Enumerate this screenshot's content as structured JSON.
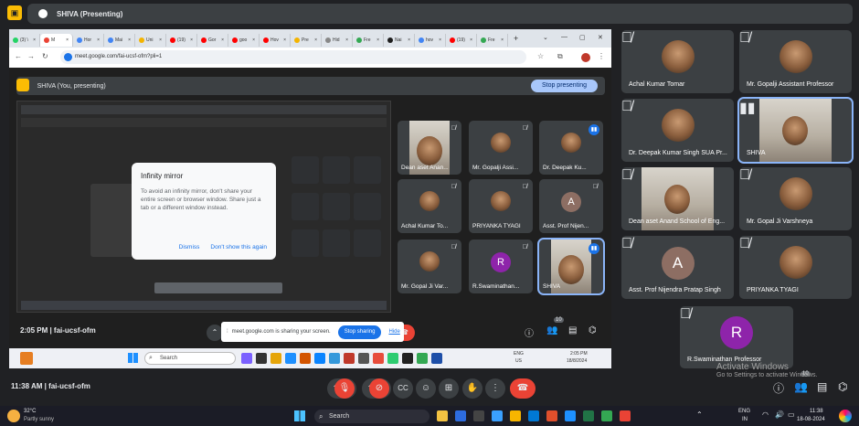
{
  "top_bar": {
    "title": "SHIVA (Presenting)"
  },
  "browser": {
    "tabs": [
      {
        "label": "(3) \\",
        "color": "#25d366",
        "active": false
      },
      {
        "label": "M",
        "color": "#ea4335",
        "active": true
      },
      {
        "label": "Hor",
        "color": "#4285f4",
        "active": false
      },
      {
        "label": "Mai",
        "color": "#4285f4",
        "active": false
      },
      {
        "label": "Uni",
        "color": "#f4b400",
        "active": false
      },
      {
        "label": "(19)",
        "color": "#ff0000",
        "active": false
      },
      {
        "label": "Gor",
        "color": "#ff0000",
        "active": false
      },
      {
        "label": "goo",
        "color": "#ff0000",
        "active": false
      },
      {
        "label": "Hov",
        "color": "#ff0000",
        "active": false
      },
      {
        "label": "Pre",
        "color": "#f4b400",
        "active": false
      },
      {
        "label": "Hid",
        "color": "#888888",
        "active": false
      },
      {
        "label": "Fre",
        "color": "#34a853",
        "active": false
      },
      {
        "label": "Nai",
        "color": "#1e1e1e",
        "active": false
      },
      {
        "label": "hov",
        "color": "#4285f4",
        "active": false
      },
      {
        "label": "(19)",
        "color": "#ff0000",
        "active": false
      },
      {
        "label": "Fre",
        "color": "#34a853",
        "active": false
      }
    ],
    "new_tab": "+",
    "window_controls": [
      "⌄",
      "—",
      "▢",
      "✕"
    ],
    "url": "meet.google.com/fai-ucsf-ofm?pli=1"
  },
  "inner_meet": {
    "presenting_label": "SHIVA (You, presenting)",
    "stop_presenting": "Stop presenting",
    "time_code": "2:05 PM  |  fai-ucsf-ofm",
    "participants_badge": "10"
  },
  "dialog": {
    "title": "Infinity mirror",
    "body": "To avoid an infinity mirror, don't share your entire screen or browser window. Share just a tab or a different window instead.",
    "dismiss": "Dismiss",
    "dont_show": "Don't show this again"
  },
  "share_bar": {
    "text": "meet.google.com is sharing your screen.",
    "stop": "Stop sharing",
    "hide": "Hide"
  },
  "inner_tiles": [
    {
      "name": "Dean aset Anan...",
      "kind": "video",
      "mic": "muted"
    },
    {
      "name": "Mr. Gopalji Assi...",
      "kind": "face",
      "mic": "muted"
    },
    {
      "name": "Dr. Deepak Ku...",
      "kind": "face",
      "mic": "speaking"
    },
    {
      "name": "Achal Kumar To...",
      "kind": "face",
      "mic": "muted"
    },
    {
      "name": "PRIYANKA TYAGI",
      "kind": "face",
      "mic": "muted"
    },
    {
      "name": "Asst. Prof Nijen...",
      "kind": "avatar",
      "letter": "A",
      "color": "#8d6e63",
      "mic": "muted"
    },
    {
      "name": "Mr. Gopal Ji Var...",
      "kind": "face",
      "mic": "muted"
    },
    {
      "name": "R.Swaminathan...",
      "kind": "avatar",
      "letter": "R",
      "color": "#8e24aa",
      "mic": "muted"
    },
    {
      "name": "SHIVA",
      "kind": "video",
      "mic": "speaking"
    }
  ],
  "inner_taskbar": {
    "search": "Search",
    "lang": "ENG",
    "region": "US",
    "time": "2:05 PM",
    "date": "18/8/2024"
  },
  "right_tiles": [
    {
      "name": "Achal Kumar Tomar",
      "kind": "face",
      "mic": "muted"
    },
    {
      "name": "Mr. Gopalji Assistant Professor",
      "kind": "face",
      "mic": "muted"
    },
    {
      "name": "Dr. Deepak Kumar Singh SUA Pr...",
      "kind": "face",
      "mic": "muted"
    },
    {
      "name": "SHIVA",
      "kind": "video",
      "mic": "speaking"
    },
    {
      "name": "Dean aset Anand School of Eng...",
      "kind": "video",
      "mic": "muted"
    },
    {
      "name": "Mr. Gopal Ji Varshneya",
      "kind": "face",
      "mic": "muted"
    },
    {
      "name": "Asst. Prof Nijendra Pratap Singh",
      "kind": "avatar",
      "letter": "A",
      "color": "#8d6e63",
      "mic": "muted"
    },
    {
      "name": "PRIYANKA TYAGI",
      "kind": "face",
      "mic": "muted"
    },
    {
      "name": "R.Swaminathan Professor",
      "kind": "avatar",
      "letter": "R",
      "color": "#8e24aa",
      "mic": "muted"
    }
  ],
  "meet_bar": {
    "time_code": "11:38 AM  |  fai-ucsf-ofm",
    "participants_badge": "10"
  },
  "watermark": {
    "line1": "Activate Windows",
    "line2": "Go to Settings to activate Windows."
  },
  "taskbar": {
    "weather_temp": "32°C",
    "weather_desc": "Partly sunny",
    "search": "Search",
    "lang": "ENG",
    "region": "IN",
    "time": "11:38",
    "date": "18-08-2024"
  },
  "colors": {
    "accent": "#1a73e8",
    "danger": "#ea4335",
    "surface": "#3c4043",
    "background": "#202124"
  }
}
